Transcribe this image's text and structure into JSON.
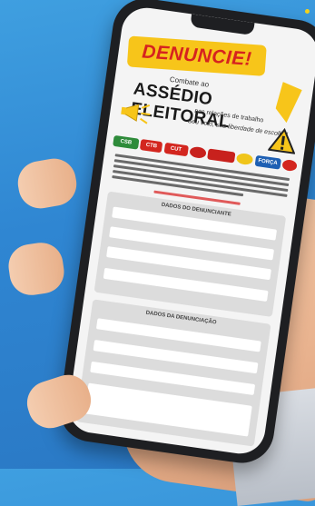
{
  "poster": {
    "headline": "DENUNCIE!",
    "subtitle_top": "Combate ao",
    "title": "ASSÉDIO ELEITORAL",
    "subtitle_bottom": "nas relações de trabalho",
    "motto": "Seu voto, sua liberdade de escolha!"
  },
  "logos": [
    {
      "label": "CSB",
      "color": "#2e8b3a"
    },
    {
      "label": "CTB",
      "color": "#d3261f"
    },
    {
      "label": "CUT",
      "color": "#d3261f"
    },
    {
      "label": "",
      "color": "#c8211d"
    },
    {
      "label": "",
      "color": "#c8211d"
    },
    {
      "label": "",
      "color": "#f0c51a"
    },
    {
      "label": "FORÇA",
      "color": "#1d5fb3"
    },
    {
      "label": "",
      "color": "#d3261f"
    }
  ],
  "form": {
    "section1_title": "DADOS DO DENUNCIANTE",
    "section2_title": "DADOS DA DENUNCIAÇÃO"
  },
  "colors": {
    "background": "#2f86d2",
    "banner": "#f7c51a",
    "banner_text": "#d6221f",
    "phone": "#1e1f22"
  }
}
